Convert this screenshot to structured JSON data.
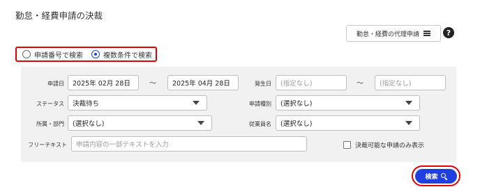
{
  "page": {
    "title": "勤怠・経費申請の決裁"
  },
  "proxy_button": {
    "label": "勤怠・経費の代理申請",
    "icon": "menu-icon"
  },
  "help": {
    "icon": "help-icon",
    "glyph": "?"
  },
  "search_mode": {
    "options": [
      {
        "label": "申請番号で検索",
        "selected": false
      },
      {
        "label": "複数条件で検索",
        "selected": true
      }
    ]
  },
  "form": {
    "application_date": {
      "label": "申請日",
      "from": "2025年 02月 28日",
      "separator": "〜",
      "to": "2025年 04月 28日"
    },
    "occurrence_date": {
      "label": "発生日",
      "from_placeholder": "(指定なし)",
      "separator": "〜",
      "to_placeholder": "(指定なし)"
    },
    "status": {
      "label": "ステータス",
      "value": "決裁待ち"
    },
    "application_type": {
      "label": "申請種別",
      "value": "(選択なし)"
    },
    "department": {
      "label": "所属・部門",
      "value": "(選択なし)"
    },
    "employee_name": {
      "label": "従業員名",
      "value": "(選択なし)"
    },
    "free_text": {
      "label": "フリーテキスト",
      "placeholder": "申請内容の一部テキストを入力",
      "value": ""
    },
    "approvable_only": {
      "label": "決裁可能な申請のみ表示",
      "checked": false
    }
  },
  "search_button": {
    "label": "検索",
    "icon": "search-icon"
  },
  "colors": {
    "accent": "#1f3fe0",
    "highlight": "#e00000",
    "panel_bg": "#f1f1f1"
  }
}
